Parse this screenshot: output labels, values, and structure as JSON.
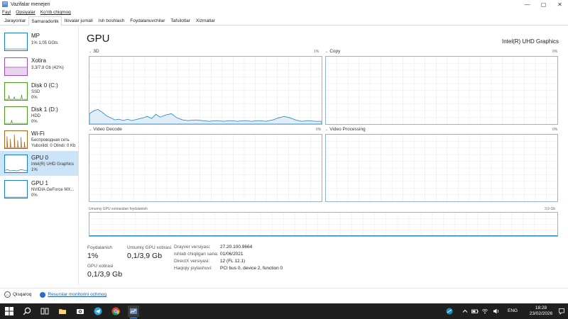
{
  "window": {
    "title": "Vazifalar menejeri",
    "buttons": {
      "minimize": "—",
      "maximize": "▢",
      "close": "✕"
    }
  },
  "menu": [
    "Fayl",
    "Opsiyalar",
    "Koʻrib chiqmoq"
  ],
  "tabs": [
    {
      "label": "Jarayonlar",
      "active": false
    },
    {
      "label": "Samaradorlik",
      "active": true
    },
    {
      "label": "Ilovalar jurnali",
      "active": false
    },
    {
      "label": "Ish boshlash",
      "active": false
    },
    {
      "label": "Foydalanuvchilar",
      "active": false
    },
    {
      "label": "Tafsilotlar",
      "active": false
    },
    {
      "label": "Xizmatlar",
      "active": false
    }
  ],
  "sidebar": {
    "items": [
      {
        "name": "MP",
        "lines": [
          "1%  1,05 GGts"
        ],
        "color": "#1a7fc1",
        "active": false
      },
      {
        "name": "Xotira",
        "lines": [
          "3,3/7,8 Gb (42%)"
        ],
        "color": "#9b4fb5",
        "active": false
      },
      {
        "name": "Disk 0 (C:)",
        "lines": [
          "SSD",
          "0%"
        ],
        "color": "#4a9c20",
        "active": false
      },
      {
        "name": "Disk 1 (D:)",
        "lines": [
          "HDD",
          "0%"
        ],
        "color": "#4a9c20",
        "active": false
      },
      {
        "name": "Wi-Fi",
        "lines": [
          "Беспроводная сеть",
          "Yuborildi: 0 Olindi: 0 Kb"
        ],
        "color": "#a7651c",
        "active": false
      },
      {
        "name": "GPU 0",
        "lines": [
          "Intel(R) UHD Graphics",
          "1%"
        ],
        "color": "#1a7fc1",
        "active": true
      },
      {
        "name": "GPU 1",
        "lines": [
          "NVIDIA GeForce MX...",
          "0%"
        ],
        "color": "#1a7fc1",
        "active": false
      }
    ]
  },
  "main": {
    "title": "GPU",
    "model": "Intel(R) UHD Graphics",
    "graphs": [
      {
        "label": "3D",
        "pct": "1%"
      },
      {
        "label": "Copy",
        "pct": "0%"
      },
      {
        "label": "Video Decode",
        "pct": "0%"
      },
      {
        "label": "Video Processing",
        "pct": "0%"
      }
    ],
    "memory_graph": {
      "label": "Umumiy GPU xotirasidan foydalanish",
      "max": "3,9 Gb"
    }
  },
  "stats": {
    "usage_label": "Foydalanish",
    "usage_value": "1%",
    "shared_mem_label": "Umumiy GPU xotirasi",
    "shared_mem_value": "0,1/3,9 Gb",
    "gpu_mem_label": "GPU xotirasi",
    "gpu_mem_value": "0,1/3,9 Gb"
  },
  "info": [
    {
      "key": "Drayver versiyasi:",
      "value": "27.20.100.9664"
    },
    {
      "key": "Ishlab chiqilgan sana:",
      "value": "01/06/2021"
    },
    {
      "key": "DirectX versiyasi:",
      "value": "12 (FL 12.1)"
    },
    {
      "key": "Haqiqiy joylashuvi:",
      "value": "PCI bus 0, device 2, function 0"
    }
  ],
  "footer": {
    "collapse_label": "Qisqaroq",
    "monitor_link": "Resurslar monitorini ochmoq"
  },
  "taskbar": {
    "language": "ENG",
    "time": "18:28",
    "date": "23/02/2026"
  },
  "colors": {
    "accent_blue": "#1a7fc1",
    "graph_border": "#8fb3d9",
    "selected_bg": "#cce4f7",
    "taskbar_bg": "#1f1f1f"
  },
  "icons": {
    "app": "task-manager-icon",
    "footer_collapse": "chevron-up-icon",
    "footer_monitor": "resource-monitor-icon",
    "taskbar": [
      "windows-start-icon",
      "search-icon",
      "task-view-icon",
      "file-explorer-icon",
      "camera-app-icon",
      "telegram-icon",
      "chrome-icon",
      "task-manager-icon"
    ]
  }
}
